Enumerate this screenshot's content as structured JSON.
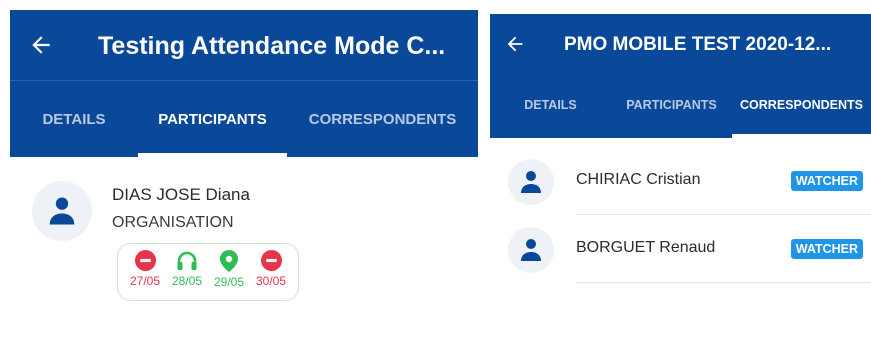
{
  "left_screen": {
    "title": "Testing Attendance Mode C...",
    "tabs": [
      {
        "label": "DETAILS",
        "active": false
      },
      {
        "label": "PARTICIPANTS",
        "active": true
      },
      {
        "label": "CORRESPONDENTS",
        "active": false
      }
    ],
    "participant": {
      "name": "DIAS JOSE Diana",
      "organisation": "ORGANISATION",
      "attendance": [
        {
          "icon": "minus-circle-icon",
          "date": "27/05",
          "color": "#e8344a"
        },
        {
          "icon": "headphones-icon",
          "date": "28/05",
          "color": "#2ebd55"
        },
        {
          "icon": "location-pin-icon",
          "date": "29/05",
          "color": "#2ebd55"
        },
        {
          "icon": "minus-circle-icon",
          "date": "30/05",
          "color": "#e8344a"
        }
      ]
    }
  },
  "right_screen": {
    "title": "PMO MOBILE TEST 2020-12...",
    "tabs": [
      {
        "label": "DETAILS",
        "active": false
      },
      {
        "label": "PARTICIPANTS",
        "active": false
      },
      {
        "label": "CORRESPONDENTS",
        "active": true
      }
    ],
    "correspondents": [
      {
        "name": "CHIRIAC Cristian",
        "role": "WATCHER"
      },
      {
        "name": "BORGUET Renaud",
        "role": "WATCHER"
      }
    ]
  },
  "colors": {
    "app_bar": "#0a4899",
    "badge": "#1f95e8",
    "absent": "#e8344a",
    "present": "#2ebd55",
    "person_icon": "#0a4899"
  }
}
